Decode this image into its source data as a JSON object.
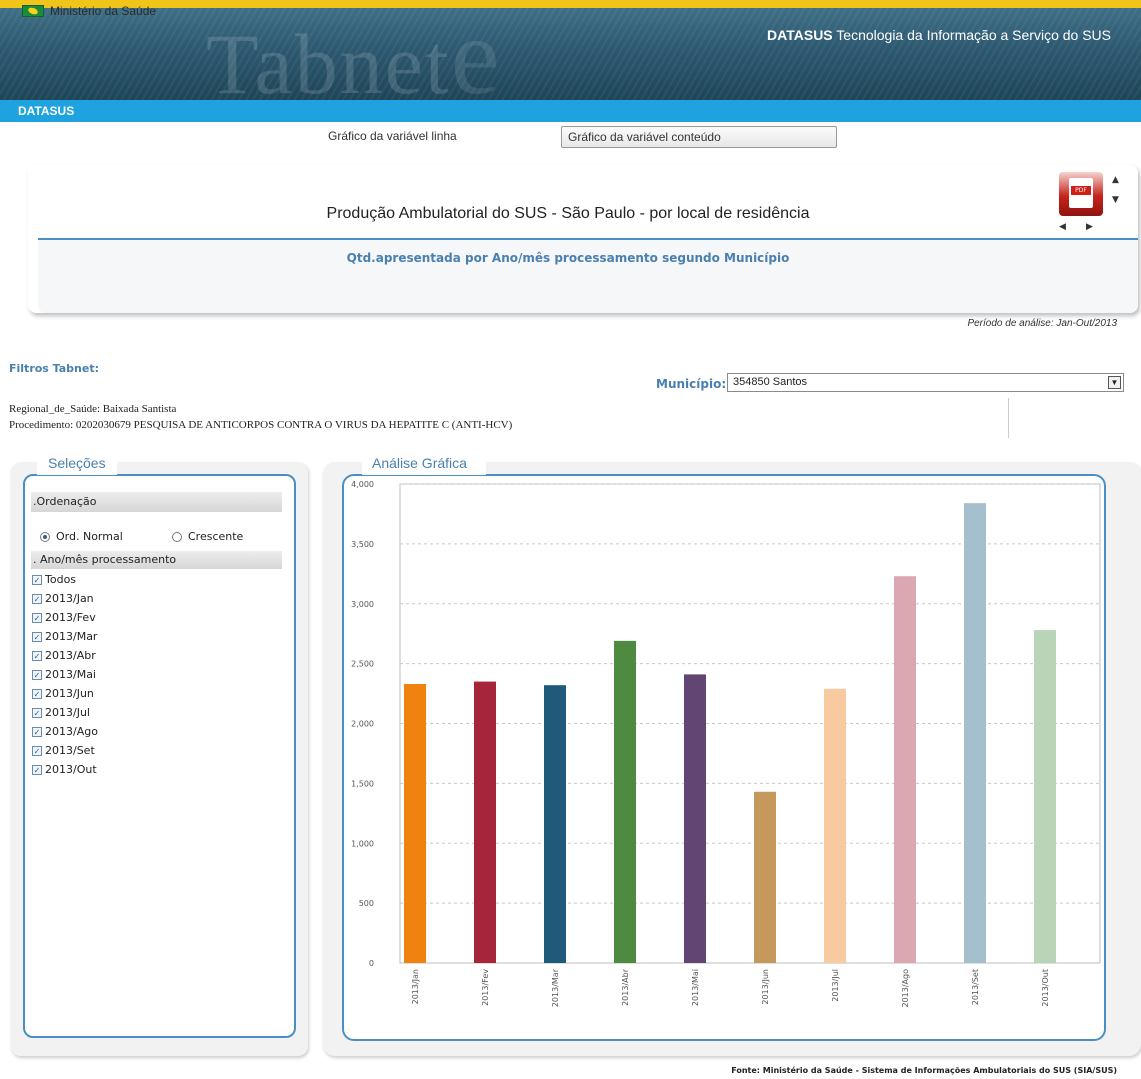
{
  "header": {
    "gov_label": "Ministério da Saúde",
    "logo_text": "Tabnet",
    "logo_e": "e",
    "brand_bold": "DATASUS",
    "brand_rest": " Tecnologia da Informação a Serviço do SUS",
    "nav_label": "DATASUS"
  },
  "tabs": {
    "line": "Gráfico da variável linha",
    "content": "Gráfico da variável conteúdo"
  },
  "title_box": {
    "title": "Produção Ambulatorial do SUS - São Paulo - por local de residência",
    "subtitle": "Qtd.apresentada por Ano/mês processamento segundo Município",
    "pdf_label": "PDF",
    "icon_colors": {
      "pdf": "#c6231b"
    }
  },
  "periodo": "Período de análise: Jan-Out/2013",
  "filters": {
    "title": "Filtros Tabnet:",
    "municipio_label": "Município:",
    "municipio_value": "354850 Santos",
    "lines": [
      "Regional_de_Saúde: Baixada Santista",
      "Procedimento: 0202030679 PESQUISA DE ANTICORPOS CONTRA O VIRUS DA HEPATITE C (ANTI-HCV)"
    ]
  },
  "selections": {
    "tab_label": "Seleções",
    "ordenacao_header": ".Ordenação",
    "radio_normal": "Ord. Normal",
    "radio_crescente": "Crescente",
    "selected_radio": "Ord. Normal",
    "ano_header": ". Ano/mês processamento",
    "items": [
      "Todos",
      "2013/Jan",
      "2013/Fev",
      "2013/Mar",
      "2013/Abr",
      "2013/Mai",
      "2013/Jun",
      "2013/Jul",
      "2013/Ago",
      "2013/Set",
      "2013/Out"
    ],
    "all_checked": true
  },
  "analysis": {
    "tab_label": "Análise Gráfica"
  },
  "chart_data": {
    "type": "bar",
    "categories": [
      "2013/Jan",
      "2013/Fev",
      "2013/Mar",
      "2013/Abr",
      "2013/Mai",
      "2013/Jun",
      "2013/Jul",
      "2013/Ago",
      "2013/Set",
      "2013/Out"
    ],
    "values": [
      2330,
      2350,
      2320,
      2690,
      2410,
      1430,
      2290,
      3230,
      3840,
      2780
    ],
    "colors": [
      "#f0820f",
      "#a6253b",
      "#1f5a7a",
      "#4e8b40",
      "#634574",
      "#c4995b",
      "#f8caa0",
      "#dba8b2",
      "#a6bfcd",
      "#b9d4b6"
    ],
    "ylim": [
      0,
      4000
    ],
    "yticks": [
      0,
      500,
      1000,
      1500,
      2000,
      2500,
      3000,
      3500,
      4000
    ],
    "ytick_labels": [
      "0",
      "500",
      "1,000",
      "1,500",
      "2,000",
      "2,500",
      "3,000",
      "3,500",
      "4,000"
    ],
    "grid": true,
    "title": "",
    "xlabel": "",
    "ylabel": ""
  },
  "footer": {
    "fonte": "Fonte: Ministério da Saúde - Sistema de Informações Ambulatoriais do SUS (SIA/SUS)"
  }
}
